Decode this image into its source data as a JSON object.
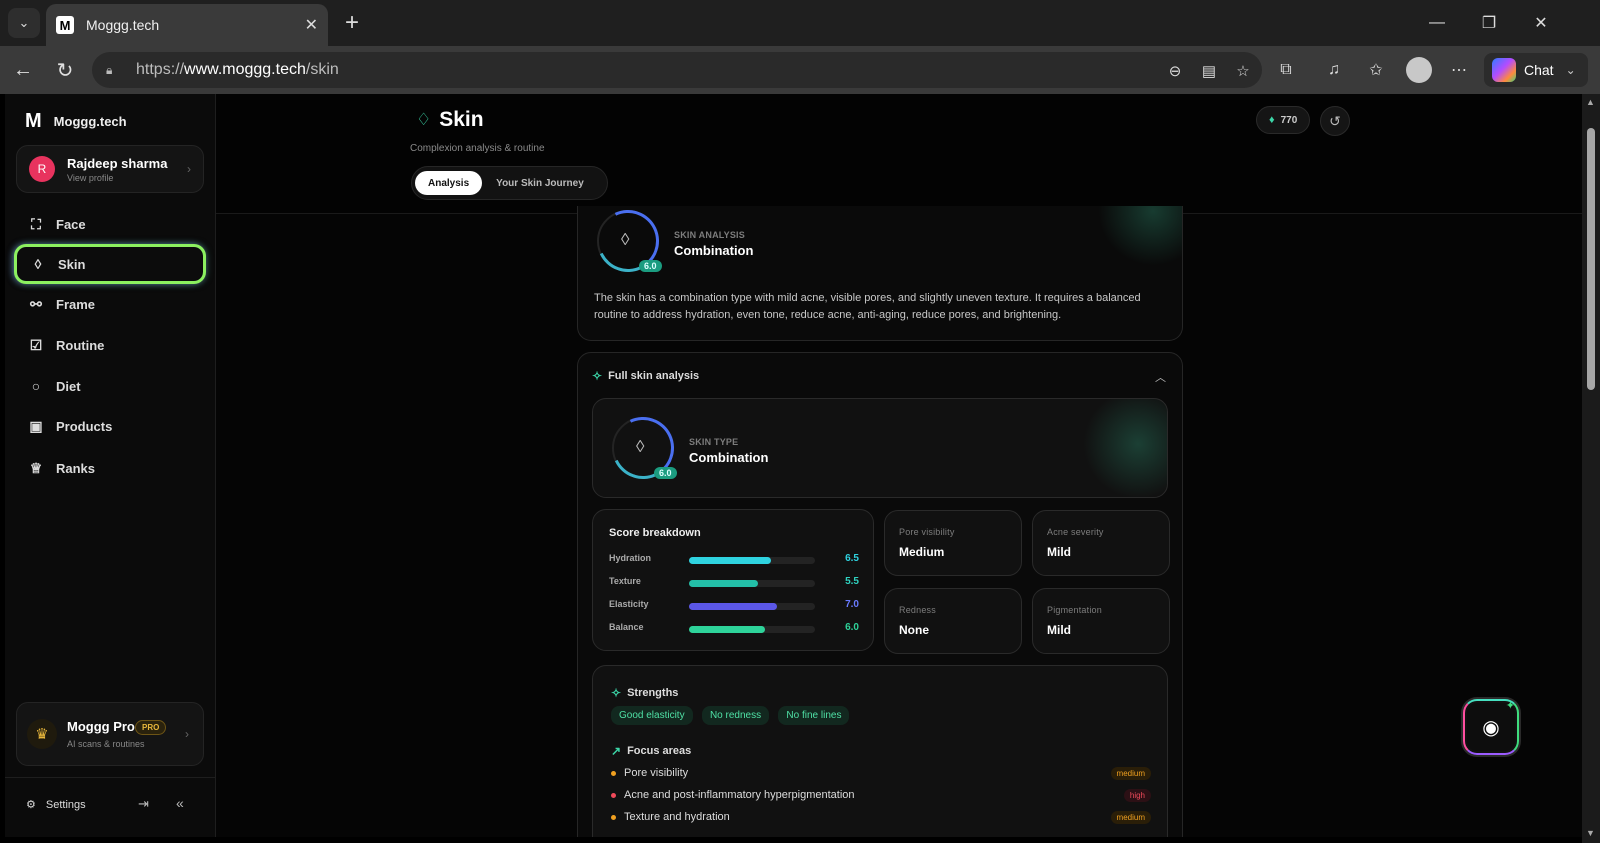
{
  "browser": {
    "tab_title": "Moggg.tech",
    "url_prefix": "https://",
    "url_domain": "www.moggg.tech",
    "url_path": "/skin",
    "chat_label": "Chat"
  },
  "sidebar": {
    "brand": "Moggg.tech",
    "profile": {
      "initial": "R",
      "name": "Rajdeep sharma",
      "sub": "View profile"
    },
    "items": [
      {
        "label": "Face",
        "icon": "face-scan-icon"
      },
      {
        "label": "Skin",
        "icon": "drop-icon",
        "active": true
      },
      {
        "label": "Frame",
        "icon": "dumbbell-icon"
      },
      {
        "label": "Routine",
        "icon": "checklist-icon"
      },
      {
        "label": "Diet",
        "icon": "apple-icon"
      },
      {
        "label": "Products",
        "icon": "bag-icon"
      },
      {
        "label": "Ranks",
        "icon": "trophy-icon"
      }
    ],
    "pro": {
      "title": "Moggg Pro",
      "badge": "PRO",
      "sub": "AI scans & routines"
    },
    "settings_label": "Settings"
  },
  "header": {
    "title": "Skin",
    "subtitle": "Complexion analysis & routine",
    "tabs": [
      "Analysis",
      "Your Skin Journey"
    ],
    "points": "770"
  },
  "summary": {
    "caption": "SKIN ANALYSIS",
    "value": "Combination",
    "score": "6.0",
    "text": "The skin has a combination type with mild acne, visible pores, and slightly uneven texture. It requires a balanced routine to address hydration, even tone, reduce acne, anti-aging, reduce pores, and brightening."
  },
  "full": {
    "title": "Full skin analysis",
    "type_caption": "SKIN TYPE",
    "type_value": "Combination",
    "score": "6.0",
    "breakdown_title": "Score breakdown",
    "breakdown": [
      {
        "label": "Hydration",
        "value": "6.5",
        "fraction": 0.65,
        "color": "#2fd3e0",
        "text_color": "#2fd3e0"
      },
      {
        "label": "Texture",
        "value": "5.5",
        "fraction": 0.55,
        "color": "#23bfa8",
        "text_color": "#2fd3c0"
      },
      {
        "label": "Elasticity",
        "value": "7.0",
        "fraction": 0.7,
        "color": "#5b57e8",
        "text_color": "#6a7bff"
      },
      {
        "label": "Balance",
        "value": "6.0",
        "fraction": 0.6,
        "color": "#2ed39a",
        "text_color": "#2ed39a"
      }
    ],
    "metrics": [
      {
        "label": "Pore visibility",
        "value": "Medium"
      },
      {
        "label": "Acne severity",
        "value": "Mild"
      },
      {
        "label": "Redness",
        "value": "None"
      },
      {
        "label": "Pigmentation",
        "value": "Mild"
      }
    ],
    "strengths_title": "Strengths",
    "strengths": [
      "Good elasticity",
      "No redness",
      "No fine lines"
    ],
    "focus_title": "Focus areas",
    "focus": [
      {
        "label": "Pore visibility",
        "level": "medium",
        "color": "#f0a020"
      },
      {
        "label": "Acne and post-inflammatory hyperpigmentation",
        "level": "high",
        "color": "#f04a5a"
      },
      {
        "label": "Texture and hydration",
        "level": "medium",
        "color": "#f0a020"
      }
    ]
  }
}
